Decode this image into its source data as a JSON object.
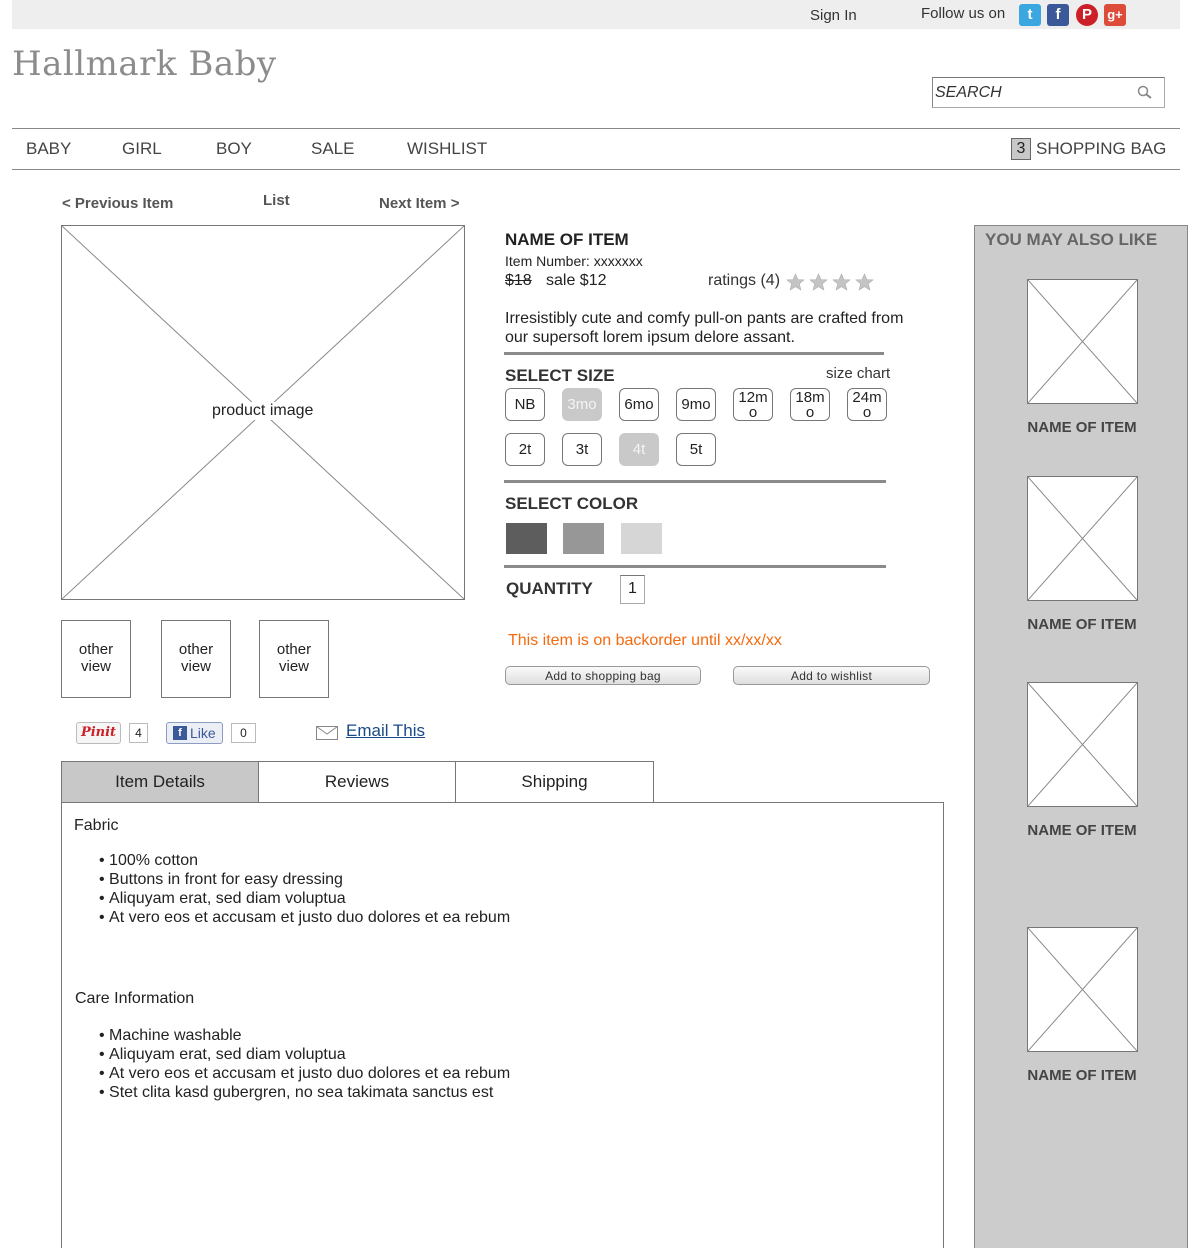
{
  "header": {
    "sign_in": "Sign In",
    "follow_label": "Follow us on",
    "social": [
      "t",
      "f",
      "P",
      "g+"
    ],
    "logo": "Hallmark Baby",
    "search_placeholder": "SEARCH"
  },
  "nav": {
    "items": [
      "BABY",
      "GIRL",
      "BOY",
      "SALE",
      "WISHLIST"
    ],
    "bag_count": "3",
    "bag_label": "SHOPPING BAG"
  },
  "item_nav": {
    "previous": "< Previous Item",
    "list": "List",
    "next": "Next Item >"
  },
  "product": {
    "image_label": "product image",
    "thumbnails": [
      "other view",
      "other view",
      "other view"
    ],
    "name": "NAME OF ITEM",
    "item_number": "Item Number: xxxxxxx",
    "price_old": "$18",
    "price_sale": "sale $12",
    "ratings_label": "ratings (4)",
    "rating": 4,
    "rating_max": 4,
    "description": "Irresistibly cute and comfy pull-on pants are crafted from our supersoft lorem ipsum delore assant."
  },
  "size": {
    "title": "SELECT SIZE",
    "chart_link": "size chart",
    "row1": [
      "NB",
      "3mo",
      "6mo",
      "9mo",
      "12mo",
      "18mo",
      "24mo"
    ],
    "row2": [
      "2t",
      "3t",
      "4t",
      "5t"
    ],
    "unavailable": [
      "3mo",
      "4t"
    ]
  },
  "color": {
    "title": "SELECT COLOR",
    "swatches": [
      "#5d5d5d",
      "#979797",
      "#d6d6d6"
    ]
  },
  "quantity": {
    "label": "QUANTITY",
    "value": "1"
  },
  "backorder": "This item is on backorder until xx/xx/xx",
  "buttons": {
    "add_bag": "Add to shopping bag",
    "add_wishlist": "Add to wishlist"
  },
  "share": {
    "pinit": "Pinit",
    "pin_count": "4",
    "like": "Like",
    "like_count": "0",
    "email": "Email This"
  },
  "tabs": [
    "Item Details",
    "Reviews",
    "Shipping"
  ],
  "details": {
    "fabric_title": "Fabric",
    "fabric": [
      "100% cotton",
      "Buttons in front for easy dressing",
      "Aliquyam erat, sed diam voluptua",
      "At vero eos et accusam et justo duo dolores et ea rebum"
    ],
    "care_title": "Care Information",
    "care": [
      "Machine washable",
      "Aliquyam erat, sed diam voluptua",
      "At vero eos et accusam et justo duo dolores et ea rebum",
      "Stet clita kasd gubergren, no sea takimata sanctus est"
    ]
  },
  "recommendations": {
    "title": "YOU MAY ALSO LIKE",
    "items": [
      "NAME OF ITEM",
      "NAME OF ITEM",
      "NAME OF ITEM",
      "NAME OF ITEM"
    ]
  },
  "colors": {
    "accent_orange": "#f56a0f",
    "link_blue": "#1a4a8a",
    "panel_gray": "#cccccc"
  }
}
